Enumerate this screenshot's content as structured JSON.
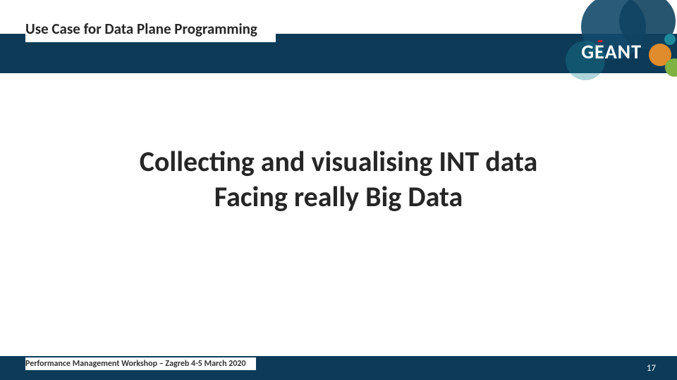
{
  "header": {
    "title": "Use Case for Data Plane Programming",
    "logo_text_1": "G",
    "logo_text_2": "E",
    "logo_text_3": "ANT"
  },
  "main": {
    "title_line1": "Collecting and visualising INT data",
    "title_line2": "Facing really Big Data"
  },
  "footer": {
    "text": "Performance Management Workshop – Zagreb 4-5 March 2020",
    "page": "17"
  },
  "colors": {
    "band": "#0c3a57",
    "accent_orange": "#e08b2c",
    "accent_teal": "#1d8a9c",
    "accent_green": "#7fb241",
    "accent_red": "#ed1c24"
  }
}
